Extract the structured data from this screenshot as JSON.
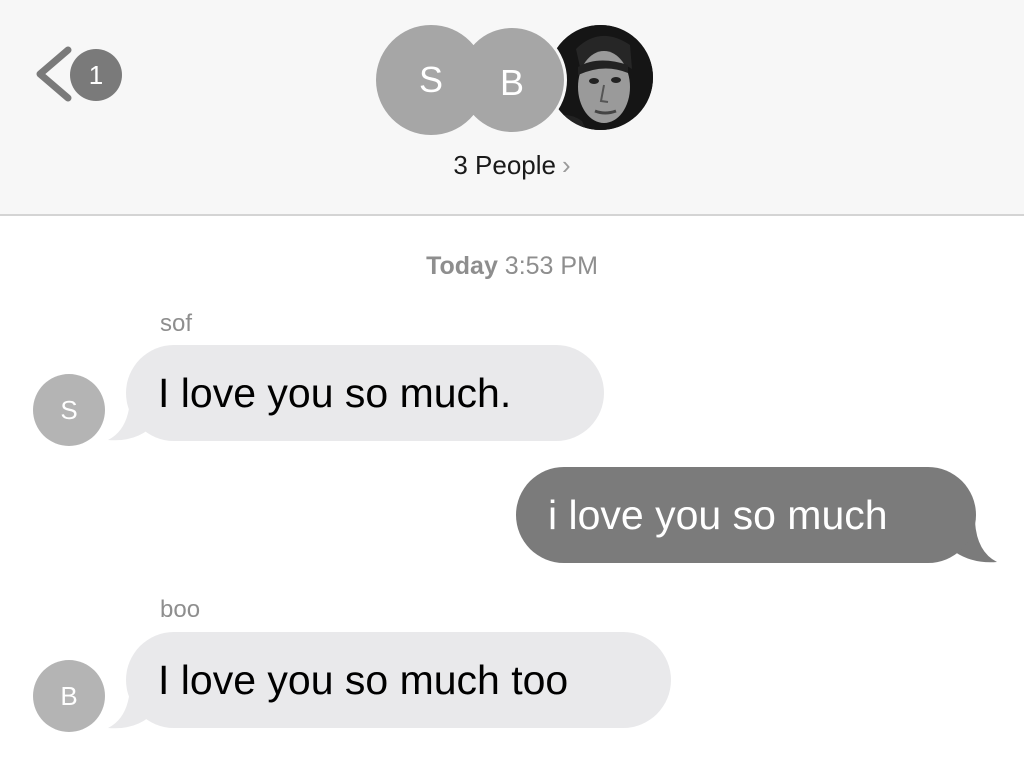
{
  "header": {
    "back_badge": "1",
    "participants": [
      {
        "initial": "S"
      },
      {
        "initial": "B"
      },
      {
        "photo": true
      }
    ],
    "group_label": "3 People",
    "group_chevron": "›"
  },
  "conversation": {
    "timestamp_day": "Today",
    "timestamp_time": "3:53 PM",
    "messages": [
      {
        "sender": "sof",
        "avatar": "S",
        "text": "I love you so much.",
        "direction": "incoming"
      },
      {
        "sender": "",
        "text": "i love you so much",
        "direction": "outgoing"
      },
      {
        "sender": "boo",
        "avatar": "B",
        "text": "I love you so much too",
        "direction": "incoming"
      }
    ]
  },
  "colors": {
    "incoming_bubble": "#e9e9eb",
    "outgoing_bubble": "#7b7b7b",
    "avatar_gray": "#a6a6a6",
    "badge": "#7a7a7a"
  }
}
